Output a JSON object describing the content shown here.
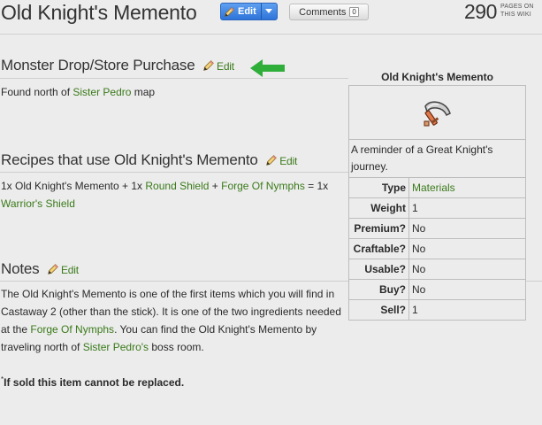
{
  "header": {
    "title": "Old Knight's Memento",
    "edit_label": "Edit",
    "comments_label": "Comments",
    "comments_count": "0",
    "pages_count": "290",
    "pages_label_line1": "PAGES ON",
    "pages_label_line2": "THIS WIKI"
  },
  "sections": {
    "drop": {
      "heading": "Monster Drop/Store Purchase",
      "edit_label": "Edit",
      "text_before": "Found north of ",
      "link": "Sister Pedro",
      "text_after": " map"
    },
    "recipes": {
      "heading": "Recipes that use Old Knight's Memento",
      "edit_label": "Edit",
      "t1": "1x Old Knight's Memento + 1x ",
      "link1": "Round Shield",
      "t2": " + ",
      "link2": "Forge Of Nymphs",
      "t3": " = 1x ",
      "link3": "Warrior's Shield"
    },
    "notes": {
      "heading": "Notes",
      "edit_label": "Edit",
      "t1": "The Old Knight's Memento is one of the first items which you will find in Castaway 2 (other than the stick). It is one of the two ingredients needed at the ",
      "link1": "Forge Of Nymphs",
      "t2": ". You can find the Old Knight's Memento by traveling north of ",
      "link2": "Sister Pedro's",
      "t3": " boss room.",
      "footnote_mark": "*",
      "footnote": "If sold this item cannot be replaced."
    }
  },
  "infobox": {
    "title": "Old Knight's Memento",
    "description": "A reminder of a Great Knight's journey.",
    "rows": [
      {
        "label": "Type",
        "value": "Materials",
        "link": true
      },
      {
        "label": "Weight",
        "value": "1",
        "link": false
      },
      {
        "label": "Premium?",
        "value": "No",
        "link": false
      },
      {
        "label": "Craftable?",
        "value": "No",
        "link": false
      },
      {
        "label": "Usable?",
        "value": "No",
        "link": false
      },
      {
        "label": "Buy?",
        "value": "No",
        "link": false
      },
      {
        "label": "Sell?",
        "value": "1",
        "link": false
      }
    ]
  },
  "colors": {
    "link": "#3a7a1a",
    "edit_button": "#2e74d9",
    "annotation_arrow": "#2fae3a",
    "background": "#ececec"
  },
  "icons": [
    "pencil-icon",
    "chevron-down-icon",
    "item-sprite-icon",
    "arrow-left-icon"
  ]
}
